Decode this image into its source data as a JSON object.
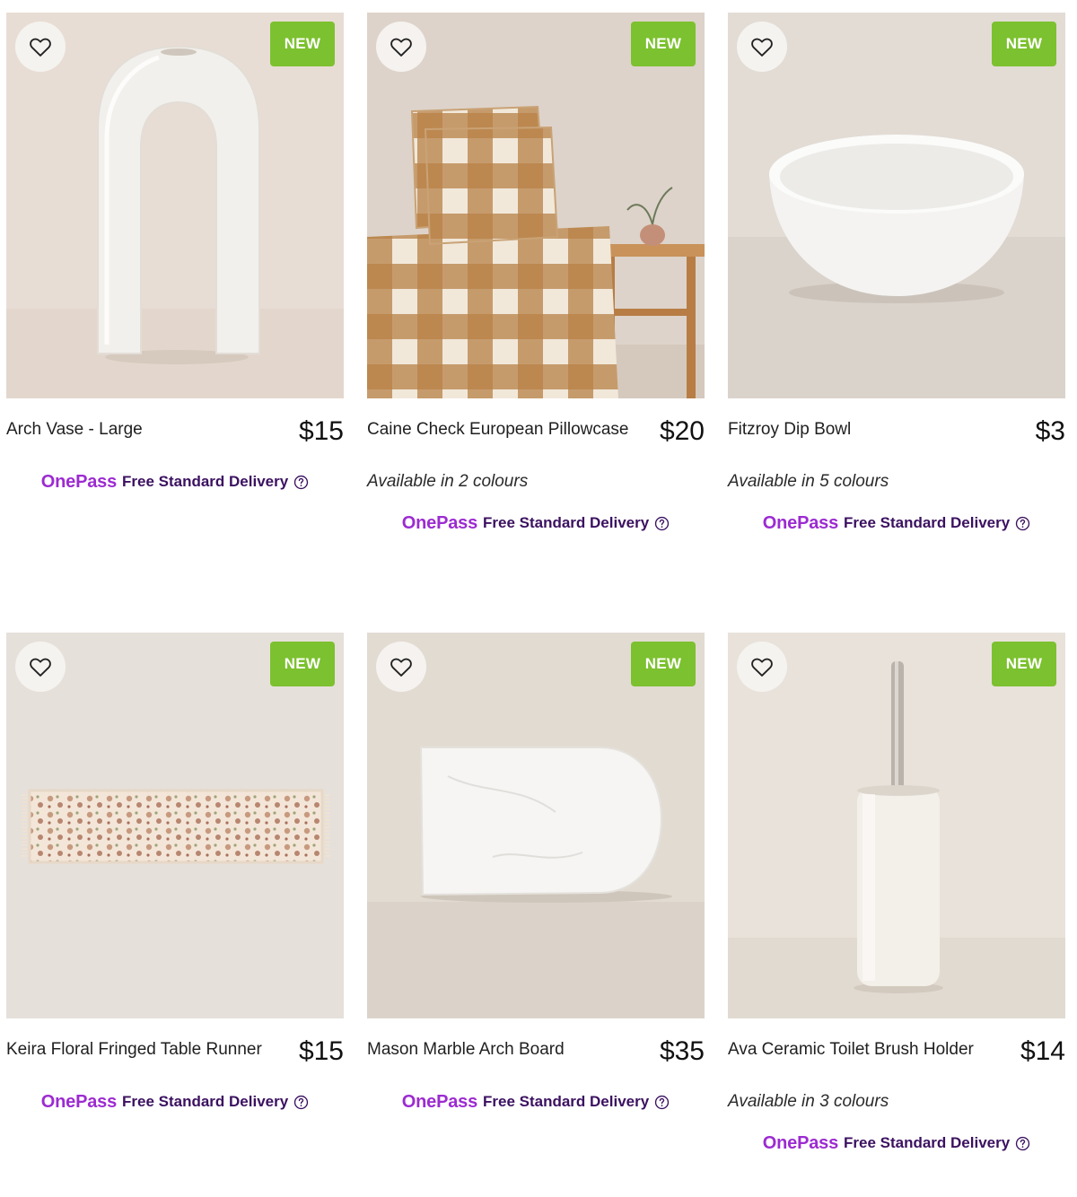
{
  "colors": {
    "badge_bg": "#7cc12f",
    "onepass_brand": "#9c2bd1",
    "delivery_text": "#3b1160"
  },
  "icons": {
    "wishlist": "heart-outline-icon",
    "help": "question-circle-icon"
  },
  "onepass": {
    "logo": "OnePass",
    "delivery_text": "Free Standard Delivery"
  },
  "products": [
    {
      "name": "Arch Vase - Large",
      "price": "$15",
      "badge": "NEW",
      "availability": "",
      "image": "white arch vase"
    },
    {
      "name": "Caine Check European Pillowcase",
      "price": "$20",
      "badge": "NEW",
      "availability": "Available in 2 colours",
      "image": "brown check pillowcase on bed"
    },
    {
      "name": "Fitzroy Dip Bowl",
      "price": "$3",
      "badge": "NEW",
      "availability": "Available in 5 colours",
      "image": "white dip bowl"
    },
    {
      "name": "Keira Floral Fringed Table Runner",
      "price": "$15",
      "badge": "NEW",
      "availability": "",
      "image": "floral fringed table runner"
    },
    {
      "name": "Mason Marble Arch Board",
      "price": "$35",
      "badge": "NEW",
      "availability": "",
      "image": "white marble arch board"
    },
    {
      "name": "Ava Ceramic Toilet Brush Holder",
      "price": "$14",
      "badge": "NEW",
      "availability": "Available in 3 colours",
      "image": "ceramic toilet brush holder"
    }
  ]
}
